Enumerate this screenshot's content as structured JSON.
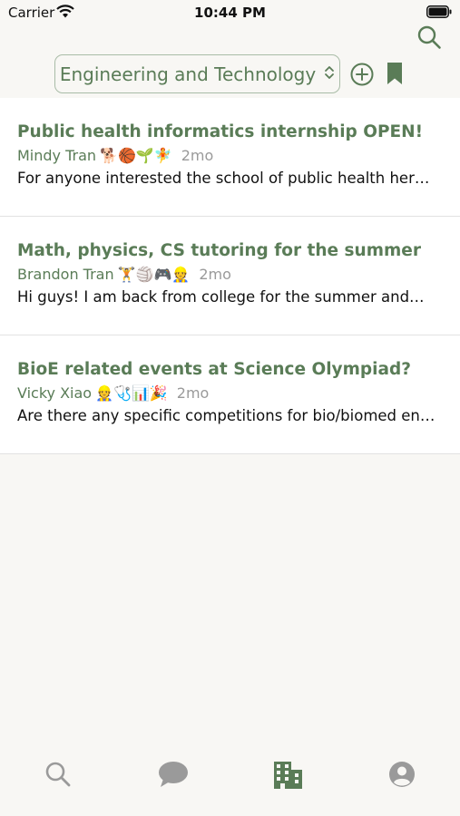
{
  "status_bar": {
    "carrier": "Carrier",
    "time": "10:44 PM"
  },
  "header": {
    "category": "Engineering and Technology",
    "icons": [
      "search-icon",
      "add-circle-icon",
      "bookmark-icon"
    ]
  },
  "posts": [
    {
      "title": "Public health informatics internship OPEN!",
      "author": "Mindy Tran",
      "emojis": "🐕🏀🌱🧚",
      "age": "2mo",
      "snippet": "For anyone interested the school of public health her…"
    },
    {
      "title": "Math, physics, CS tutoring for the summer",
      "author": "Brandon Tran",
      "emojis": "🏋🏐🎮👷",
      "age": "2mo",
      "snippet": "Hi guys! I am back from college for the summer and…"
    },
    {
      "title": "BioE related events at Science Olympiad?",
      "author": "Vicky Xiao",
      "emojis": "👷🩺📊🎉",
      "age": "2mo",
      "snippet": "Are there any specific competitions for bio/biomed en…"
    }
  ],
  "tab_bar": {
    "tabs": [
      "search-icon",
      "chat-bubble-icon",
      "buildings-icon",
      "profile-icon"
    ],
    "active": "buildings-icon"
  },
  "colors": {
    "accent": "#5a7c57",
    "background": "#f8f7f4",
    "inactive": "#9a9a9a"
  }
}
